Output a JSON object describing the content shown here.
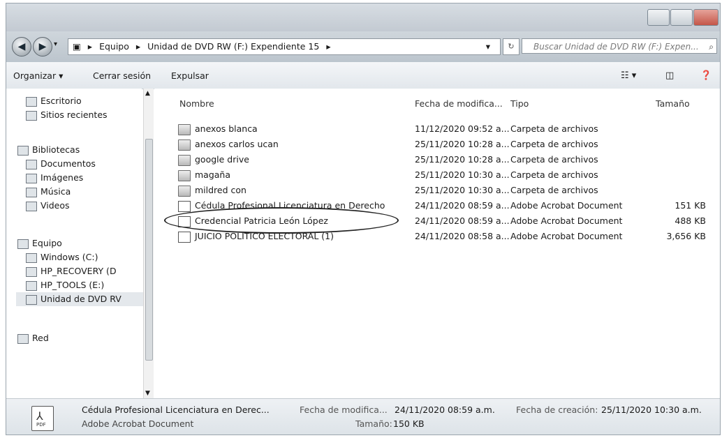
{
  "address": {
    "crumbs": [
      "Equipo",
      "Unidad de DVD RW (F:) Expendiente 15"
    ],
    "search_placeholder": "Buscar Unidad de DVD RW (F:) Expen..."
  },
  "toolbar": {
    "organize": "Organizar",
    "logout": "Cerrar sesión",
    "eject": "Expulsar"
  },
  "nav": {
    "items": [
      {
        "label": "Escritorio",
        "indent": 1
      },
      {
        "label": "Sitios recientes",
        "indent": 1
      },
      {
        "label": "Bibliotecas",
        "indent": 0
      },
      {
        "label": "Documentos",
        "indent": 1
      },
      {
        "label": "Imágenes",
        "indent": 1
      },
      {
        "label": "Música",
        "indent": 1
      },
      {
        "label": "Videos",
        "indent": 1
      },
      {
        "label": "Equipo",
        "indent": 0
      },
      {
        "label": "Windows (C:)",
        "indent": 1
      },
      {
        "label": "HP_RECOVERY (D",
        "indent": 1
      },
      {
        "label": "HP_TOOLS (E:)",
        "indent": 1
      },
      {
        "label": "Unidad de DVD RV",
        "indent": 1
      },
      {
        "label": "Red",
        "indent": 0
      }
    ]
  },
  "columns": {
    "name": "Nombre",
    "date": "Fecha de modifica...",
    "type": "Tipo",
    "size": "Tamaño"
  },
  "files": [
    {
      "name": "anexos blanca",
      "date": "11/12/2020 09:52 a...",
      "type": "Carpeta de archivos",
      "size": "",
      "icon": "folder-icon"
    },
    {
      "name": "anexos carlos ucan",
      "date": "25/11/2020 10:28 a...",
      "type": "Carpeta de archivos",
      "size": "",
      "icon": "folder-icon"
    },
    {
      "name": "google drive",
      "date": "25/11/2020 10:28 a...",
      "type": "Carpeta de archivos",
      "size": "",
      "icon": "folder-icon"
    },
    {
      "name": "magaña",
      "date": "25/11/2020 10:30 a...",
      "type": "Carpeta de archivos",
      "size": "",
      "icon": "folder-icon"
    },
    {
      "name": "mildred con",
      "date": "25/11/2020 10:30 a...",
      "type": "Carpeta de archivos",
      "size": "",
      "icon": "folder-icon"
    },
    {
      "name": "Cédula Profesional Licenciatura en Derecho",
      "date": "24/11/2020 08:59 a...",
      "type": "Adobe Acrobat Document",
      "size": "151 KB",
      "icon": "pdf-icon"
    },
    {
      "name": "Credencial Patricia León López",
      "date": "24/11/2020 08:59 a...",
      "type": "Adobe Acrobat Document",
      "size": "488 KB",
      "icon": "pdf-icon"
    },
    {
      "name": "JUICIO POLITICO ELECTORAL (1)",
      "date": "24/11/2020 08:58 a...",
      "type": "Adobe Acrobat Document",
      "size": "3,656 KB",
      "icon": "pdf-icon"
    }
  ],
  "details": {
    "filename": "Cédula Profesional Licenciatura en Derec...",
    "filetype": "Adobe Acrobat Document",
    "modified_label": "Fecha de modifica...",
    "modified_value": "24/11/2020 08:59 a.m.",
    "size_label": "Tamaño:",
    "size_value": "150 KB",
    "created_label": "Fecha de creación:",
    "created_value": "25/11/2020 10:30 a.m."
  }
}
